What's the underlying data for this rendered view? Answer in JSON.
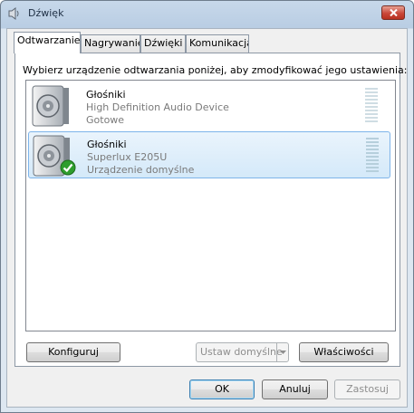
{
  "window": {
    "title": "Dźwięk"
  },
  "tabs": [
    {
      "label": "Odtwarzanie",
      "active": true
    },
    {
      "label": "Nagrywanie",
      "active": false
    },
    {
      "label": "Dźwięki",
      "active": false
    },
    {
      "label": "Komunikacja",
      "active": false
    }
  ],
  "instruction": "Wybierz urządzenie odtwarzania poniżej, aby zmodyfikować jego ustawienia:",
  "devices": [
    {
      "name": "Głośniki",
      "description": "High Definition Audio Device",
      "status": "Gotowe",
      "icon": "speaker-icon",
      "selected": false,
      "is_default": false
    },
    {
      "name": "Głośniki",
      "description": "Superlux E205U",
      "status": "Urządzenie domyślne",
      "icon": "speaker-icon",
      "selected": true,
      "is_default": true
    }
  ],
  "buttons": {
    "configure": "Konfiguruj",
    "set_default": "Ustaw domyślne",
    "properties": "Właściwości",
    "ok": "OK",
    "cancel": "Anuluj",
    "apply": "Zastosuj"
  },
  "colors": {
    "selection": "#d4e9f9",
    "selection_border": "#7eb4ea",
    "check": "#2e9d2e"
  }
}
